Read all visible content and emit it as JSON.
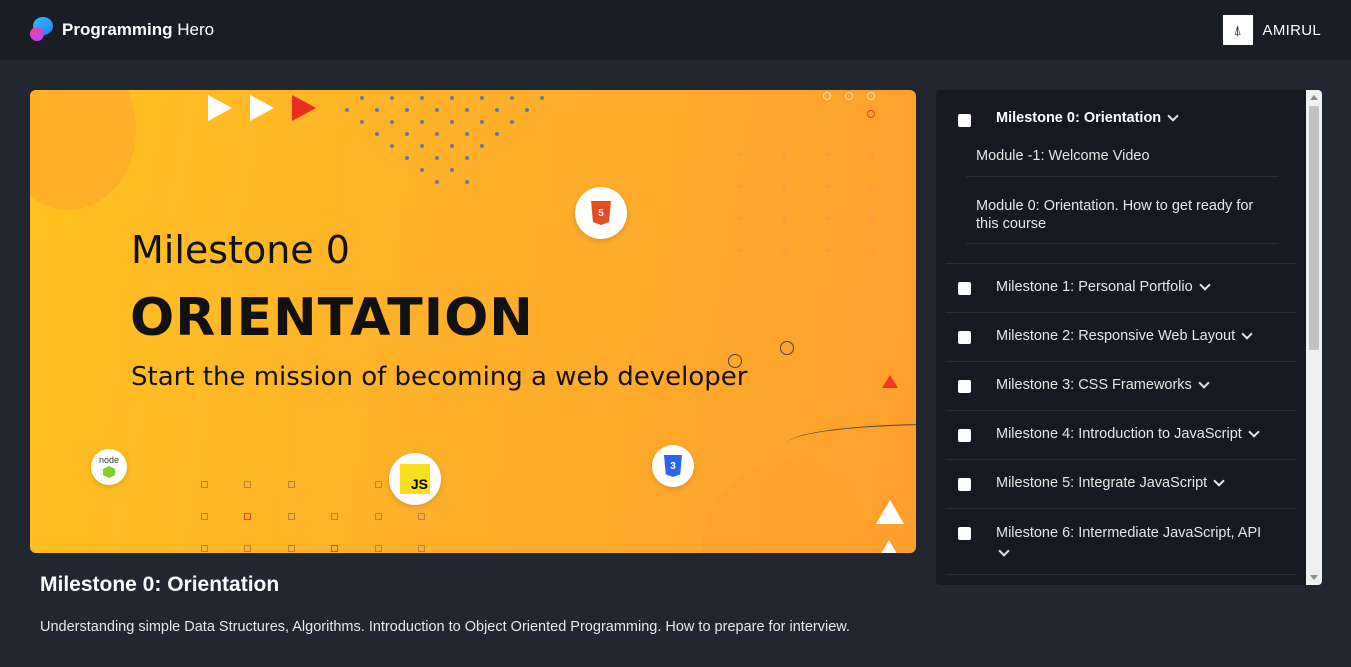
{
  "header": {
    "brand_bold": "Programming",
    "brand_light": " Hero",
    "user_name": "AMIRUL"
  },
  "banner": {
    "eyebrow": "Milestone 0",
    "title": "ORIENTATION",
    "subtitle": "Start the mission of becoming a web developer",
    "badges": {
      "html": "5",
      "css": "3",
      "js": "JS",
      "node": "node"
    }
  },
  "video": {
    "title": "Milestone 0: Orientation",
    "description": "Understanding simple Data Structures, Algorithms. Introduction to Object Oriented Programming. How to prepare for interview."
  },
  "sidebar": {
    "milestones": [
      {
        "label": "Milestone 0: Orientation",
        "expanded": true,
        "modules": [
          "Module -1: Welcome Video",
          "Module 0: Orientation. How to get ready for this course"
        ]
      },
      {
        "label": "Milestone 1: Personal Portfolio"
      },
      {
        "label": "Milestone 2: Responsive Web Layout"
      },
      {
        "label": "Milestone 3: CSS Frameworks"
      },
      {
        "label": "Milestone 4: Introduction to JavaScript"
      },
      {
        "label": "Milestone 5: Integrate JavaScript"
      },
      {
        "label": "Milestone 6: Intermediate JavaScript, API"
      }
    ]
  },
  "colors": {
    "background": "#222630",
    "topbar": "#1a1d24",
    "sidebar": "#161922",
    "banner_orange": "#ffb129"
  }
}
